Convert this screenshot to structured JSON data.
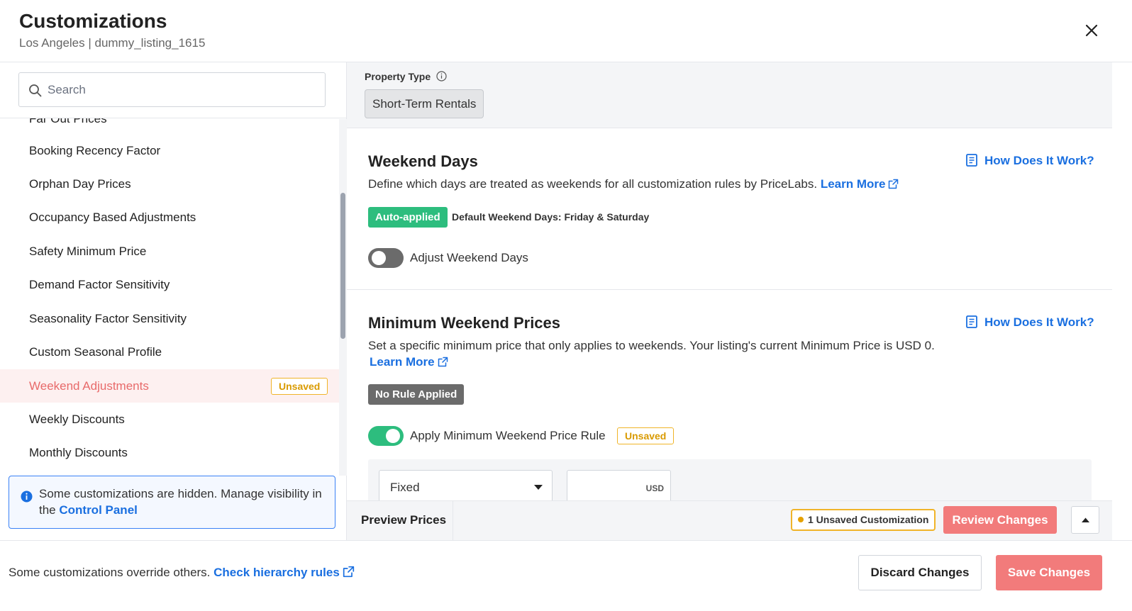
{
  "header": {
    "title": "Customizations",
    "subtitle": "Los Angeles | dummy_listing_1615",
    "close_icon": "close-icon"
  },
  "sidebar": {
    "search_placeholder": "Search",
    "items": [
      {
        "label": "Far Out Prices"
      },
      {
        "label": "Booking Recency Factor"
      },
      {
        "label": "Orphan Day Prices"
      },
      {
        "label": "Occupancy Based Adjustments"
      },
      {
        "label": "Safety Minimum Price"
      },
      {
        "label": "Demand Factor Sensitivity"
      },
      {
        "label": "Seasonality Factor Sensitivity"
      },
      {
        "label": "Custom Seasonal Profile"
      },
      {
        "label": "Weekend Adjustments",
        "active": true,
        "badge": "Unsaved"
      },
      {
        "label": "Weekly Discounts"
      },
      {
        "label": "Monthly Discounts"
      }
    ],
    "info": {
      "text": "Some customizations are hidden. Manage visibility in the ",
      "link": "Control Panel"
    }
  },
  "property_type": {
    "label": "Property Type",
    "value": "Short-Term Rentals"
  },
  "weekend_days": {
    "title": "Weekend Days",
    "description": "Define which days are treated as weekends for all customization rules by PriceLabs.",
    "learn_more": "Learn More",
    "how_link": "How Does It Work?",
    "badge": "Auto-applied",
    "default_text": "Default Weekend Days: Friday & Saturday",
    "toggle_label": "Adjust Weekend Days",
    "toggle_on": false
  },
  "min_weekend_prices": {
    "title": "Minimum Weekend Prices",
    "description": "Set a specific minimum price that only applies to weekends. Your listing's current Minimum Price is USD 0.",
    "learn_more": "Learn More",
    "how_link": "How Does It Work?",
    "badge": "No Rule Applied",
    "toggle_label": "Apply Minimum Weekend Price Rule",
    "toggle_on": true,
    "toggle_badge": "Unsaved",
    "type_select": "Fixed",
    "amount_unit": "USD"
  },
  "preview_bar": {
    "preview_tab": "Preview Prices",
    "unsaved_count": "1 Unsaved Customization",
    "review_button": "Review Changes"
  },
  "footer": {
    "text": "Some customizations override others.",
    "link": "Check hierarchy rules",
    "discard_button": "Discard Changes",
    "save_button": "Save Changes"
  },
  "colors": {
    "accent_blue": "#1a6fe0",
    "active_red": "#e86a6a",
    "button_red": "#f27b7b",
    "green": "#2dbd7e",
    "warning": "#f0b429"
  }
}
